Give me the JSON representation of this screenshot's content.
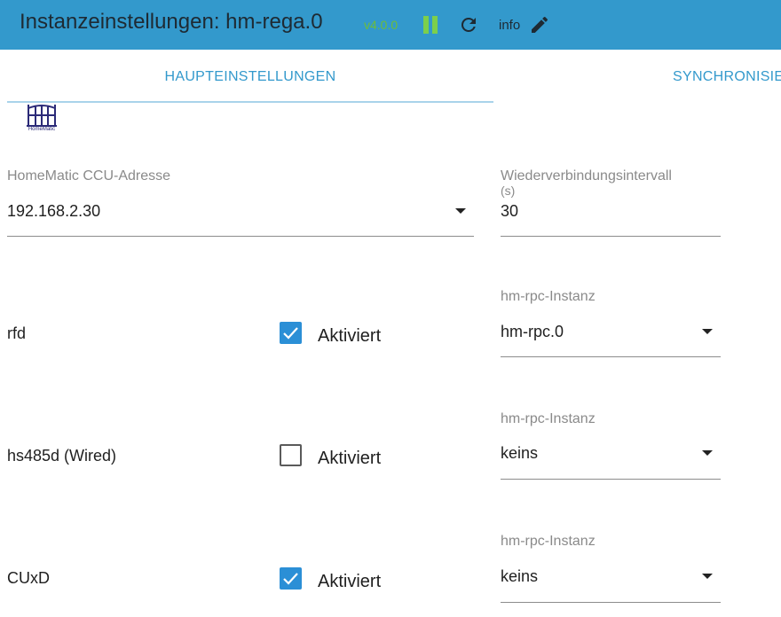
{
  "header": {
    "title": "Instanzeinstellungen: hm-rega.0",
    "version": "v4.0.0",
    "info_label": "info"
  },
  "tabs": [
    {
      "label": "HAUPTEINSTELLUNGEN",
      "active": true
    },
    {
      "label": "SYNCHRONISIE",
      "active": false
    }
  ],
  "logo": {
    "text": "HomeMatic"
  },
  "ccu_address": {
    "label": "HomeMatic CCU-Adresse",
    "value": "192.168.2.30"
  },
  "reconnect_interval": {
    "label_line1": "Wiederverbindungsintervall",
    "label_line2": "(s)",
    "value": "30"
  },
  "interfaces": [
    {
      "name": "rfd",
      "checked": true,
      "check_label": "Aktiviert",
      "instance_label": "hm-rpc-Instanz",
      "instance_value": "hm-rpc.0"
    },
    {
      "name": "hs485d (Wired)",
      "checked": false,
      "check_label": "Aktiviert",
      "instance_label": "hm-rpc-Instanz",
      "instance_value": "keins"
    },
    {
      "name": "CUxD",
      "checked": true,
      "check_label": "Aktiviert",
      "instance_label": "hm-rpc-Instanz",
      "instance_value": "keins"
    }
  ],
  "colors": {
    "header_bg": "#3399cc",
    "accent": "#3399cc",
    "checkbox_checked": "#2b8fd6",
    "version": "#6dbd3a"
  },
  "icons": [
    "pause-icon",
    "reload-icon",
    "pencil-icon",
    "chevron-down-icon",
    "check-icon"
  ]
}
